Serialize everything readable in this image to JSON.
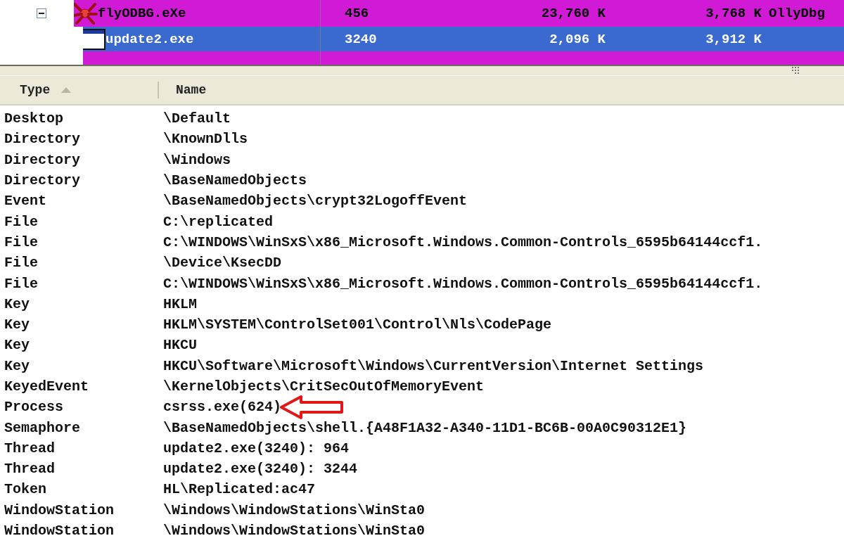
{
  "process_tree": [
    {
      "name": "flyODBG.eXe",
      "pid": "456",
      "private_bytes": "23,760 K",
      "working_set": "3,768 K",
      "description": "OllyDbg",
      "kind": "debugger",
      "color": "#d01ad6",
      "selected": false,
      "expanded": true,
      "children": [
        {
          "name": "update2.exe",
          "pid": "3240",
          "private_bytes": "2,096 K",
          "working_set": "3,912 K",
          "kind": "app",
          "selected": true
        },
        {
          "color": "#d01ad6",
          "selected": false
        }
      ]
    }
  ],
  "handles": {
    "columns": [
      {
        "label": "Type",
        "sorted": true
      },
      {
        "label": "Name",
        "sorted": false
      }
    ],
    "rows": [
      {
        "type": "Desktop",
        "name": "\\Default",
        "pointed": false
      },
      {
        "type": "Directory",
        "name": "\\KnownDlls",
        "pointed": false
      },
      {
        "type": "Directory",
        "name": "\\Windows",
        "pointed": false
      },
      {
        "type": "Directory",
        "name": "\\BaseNamedObjects",
        "pointed": false
      },
      {
        "type": "Event",
        "name": "\\BaseNamedObjects\\crypt32LogoffEvent",
        "pointed": false
      },
      {
        "type": "File",
        "name": "C:\\replicated",
        "pointed": false
      },
      {
        "type": "File",
        "name": "C:\\WINDOWS\\WinSxS\\x86_Microsoft.Windows.Common-Controls_6595b64144ccf1.",
        "pointed": false
      },
      {
        "type": "File",
        "name": "\\Device\\KsecDD",
        "pointed": false
      },
      {
        "type": "File",
        "name": "C:\\WINDOWS\\WinSxS\\x86_Microsoft.Windows.Common-Controls_6595b64144ccf1.",
        "pointed": false
      },
      {
        "type": "Key",
        "name": "HKLM",
        "pointed": false
      },
      {
        "type": "Key",
        "name": "HKLM\\SYSTEM\\ControlSet001\\Control\\Nls\\CodePage",
        "pointed": false
      },
      {
        "type": "Key",
        "name": "HKCU",
        "pointed": false
      },
      {
        "type": "Key",
        "name": "HKCU\\Software\\Microsoft\\Windows\\CurrentVersion\\Internet Settings",
        "pointed": false
      },
      {
        "type": "KeyedEvent",
        "name": "\\KernelObjects\\CritSecOutOfMemoryEvent",
        "pointed": false
      },
      {
        "type": "Process",
        "name": "csrss.exe(624)",
        "pointed": true
      },
      {
        "type": "Semaphore",
        "name": "\\BaseNamedObjects\\shell.{A48F1A32-A340-11D1-BC6B-00A0C90312E1}",
        "pointed": false
      },
      {
        "type": "Thread",
        "name": "update2.exe(3240): 964",
        "pointed": false
      },
      {
        "type": "Thread",
        "name": "update2.exe(3240): 3244",
        "pointed": false
      },
      {
        "type": "Token",
        "name": "HL\\Replicated:ac47",
        "pointed": false
      },
      {
        "type": "WindowStation",
        "name": "\\Windows\\WindowStations\\WinSta0",
        "pointed": false
      },
      {
        "type": "WindowStation",
        "name": "\\Windows\\WindowStations\\WinSta0",
        "pointed": false
      }
    ]
  }
}
